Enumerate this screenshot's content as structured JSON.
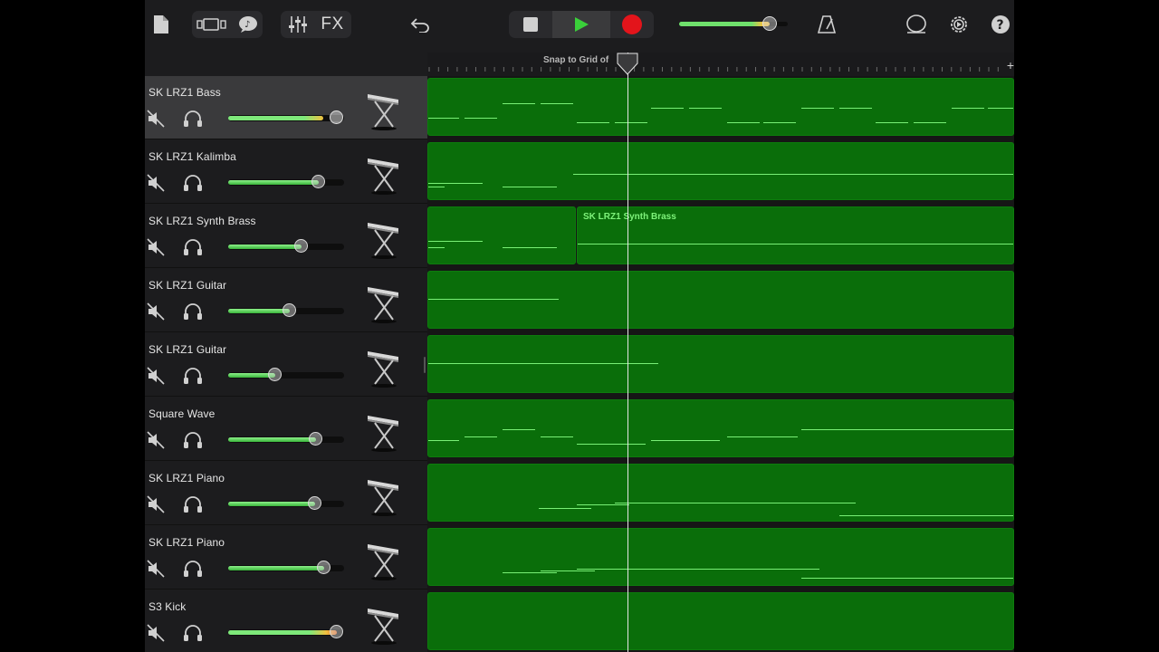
{
  "toolbar": {
    "fx_label": "FX",
    "master_volume": 0.83,
    "icons": [
      "my-songs-icon",
      "browser-icon",
      "loops-icon",
      "mixer-icon",
      "undo-icon",
      "stop-icon",
      "play-icon",
      "record-icon",
      "metronome-icon",
      "loop-browser-icon",
      "settings-icon",
      "help-icon"
    ]
  },
  "ruler": {
    "snap_label": "Snap to Grid of"
  },
  "tracks": [
    {
      "name": "SK LRZ1 Bass",
      "volume": 0.82,
      "selected": true,
      "color": "#c8c8c8"
    },
    {
      "name": "SK LRZ1 Kalimba",
      "volume": 0.78
    },
    {
      "name": "SK LRZ1 Synth Brass",
      "volume": 0.63
    },
    {
      "name": "SK LRZ1 Guitar",
      "volume": 0.53
    },
    {
      "name": "SK LRZ1 Guitar",
      "volume": 0.41
    },
    {
      "name": "Square Wave",
      "volume": 0.76
    },
    {
      "name": "SK LRZ1 Piano",
      "volume": 0.75
    },
    {
      "name": "SK LRZ1 Piano",
      "volume": 0.83
    },
    {
      "name": "S3 Kick",
      "volume": 0.94
    }
  ],
  "regions": {
    "synth_brass_label": "SK LRZ1 Synth Brass"
  },
  "colors": {
    "region": "#0a6e0a",
    "note": "#79f076",
    "record": "#e3141b",
    "play": "#3ad03a"
  }
}
